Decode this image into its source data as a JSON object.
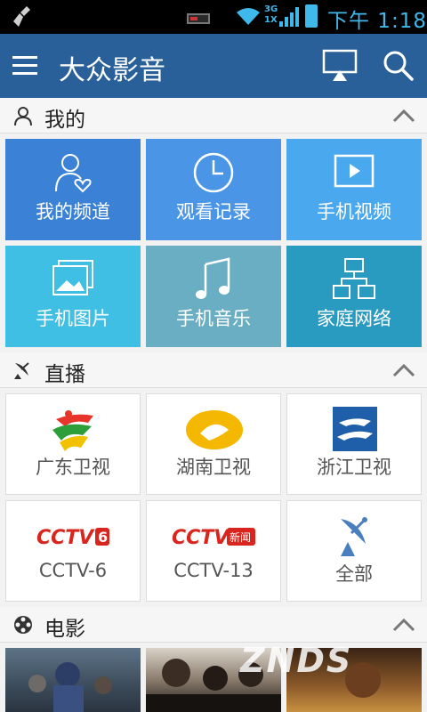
{
  "status_bar": {
    "network_label": "3G\n1X",
    "time": "下午 1:18"
  },
  "header": {
    "title": "大众影音"
  },
  "sections": {
    "mine": {
      "title": "我的"
    },
    "live": {
      "title": "直播"
    },
    "movie": {
      "title": "电影"
    }
  },
  "mine_tiles": [
    {
      "label": "我的频道",
      "color": "#3b82d6"
    },
    {
      "label": "观看记录",
      "color": "#4a95e6"
    },
    {
      "label": "手机视频",
      "color": "#4aa9ee"
    },
    {
      "label": "手机图片",
      "color": "#3fbfe3"
    },
    {
      "label": "手机音乐",
      "color": "#6aaec4"
    },
    {
      "label": "家庭网络",
      "color": "#2a9bc0"
    }
  ],
  "live_channels": [
    {
      "label": "广东卫视",
      "logo": "guangdong-tv-logo"
    },
    {
      "label": "湖南卫视",
      "logo": "hunan-tv-logo"
    },
    {
      "label": "浙江卫视",
      "logo": "zhejiang-tv-logo"
    },
    {
      "label": "CCTV-6",
      "logo": "cctv6-logo",
      "logo_text": "CCTV",
      "logo_suffix": "6"
    },
    {
      "label": "CCTV-13",
      "logo": "cctv13-logo",
      "logo_text": "CCTV",
      "logo_suffix": "新闻"
    },
    {
      "label": "全部",
      "logo": "satellite-dish-icon"
    }
  ],
  "watermark": "ZNDS"
}
